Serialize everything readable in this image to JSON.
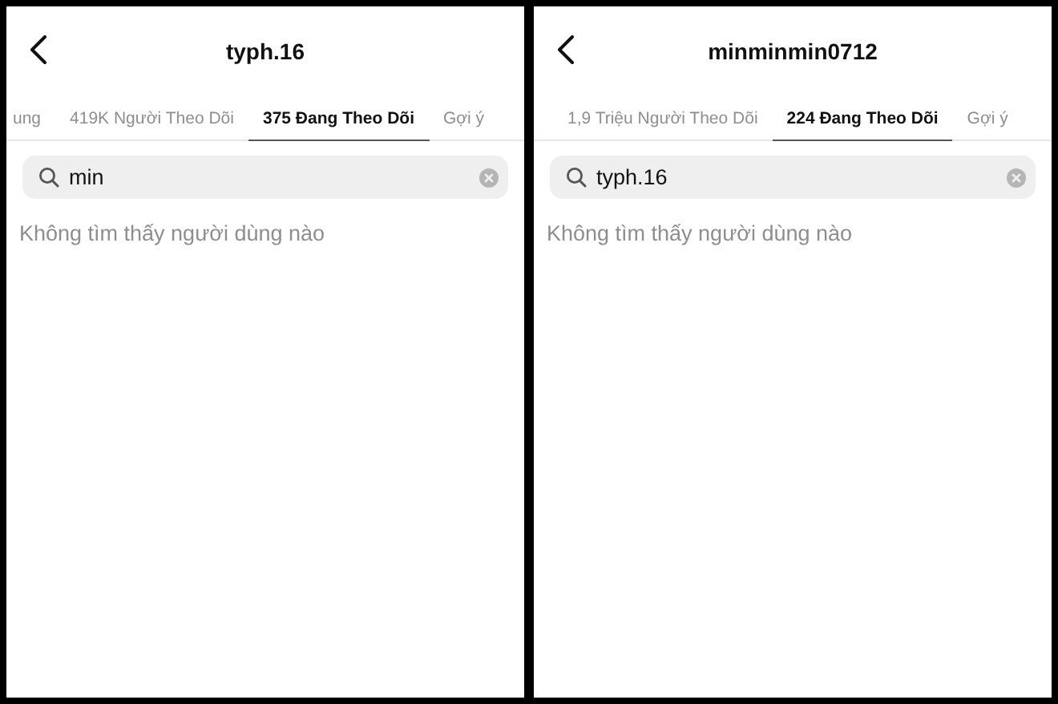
{
  "panels": [
    {
      "title": "typh.16",
      "tabs": [
        {
          "label": "ung",
          "selected": false
        },
        {
          "label": "419K Người Theo Dõi",
          "selected": false
        },
        {
          "label": "375 Đang Theo Dõi",
          "selected": true
        },
        {
          "label": "Gợi ý",
          "selected": false
        }
      ],
      "search": {
        "value": "min"
      },
      "empty_message": "Không tìm thấy người dùng nào"
    },
    {
      "title": "minminmin0712",
      "tabs": [
        {
          "label": "1,9 Triệu Người Theo Dõi",
          "selected": false
        },
        {
          "label": "224 Đang Theo Dõi",
          "selected": true
        },
        {
          "label": "Gợi ý",
          "selected": false
        }
      ],
      "search": {
        "value": "typh.16"
      },
      "empty_message": "Không tìm thấy người dùng nào"
    }
  ]
}
